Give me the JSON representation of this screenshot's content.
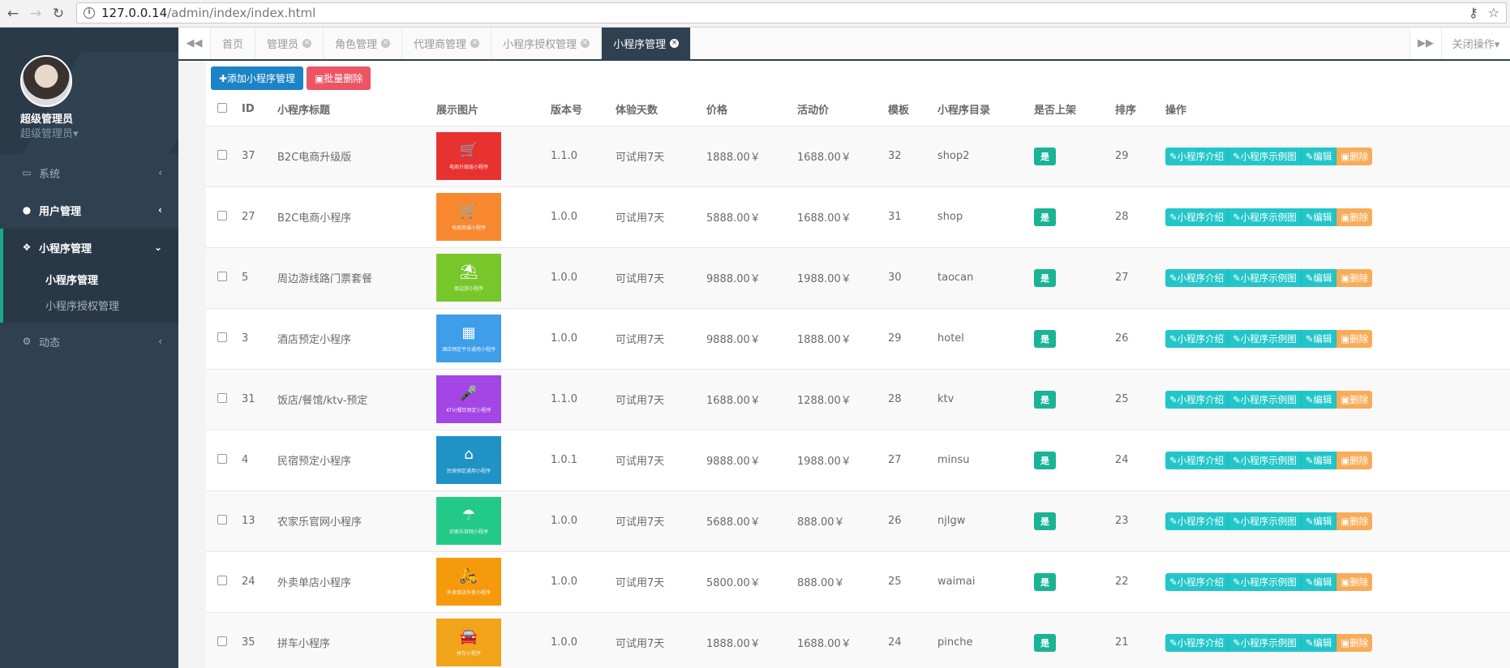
{
  "browser": {
    "url_host": "127.0.0.14",
    "url_path": "/admin/index/index.html"
  },
  "sidebar": {
    "user_name": "超级管理员",
    "user_role": "超级管理员▾",
    "menu": [
      {
        "label": "系统",
        "icon": "monitor-icon"
      },
      {
        "label": "用户管理",
        "icon": "user-icon"
      },
      {
        "label": "小程序管理",
        "icon": "wechat-icon"
      },
      {
        "label": "动态",
        "icon": "cogs-icon"
      }
    ],
    "submenu": [
      "小程序管理",
      "小程序授权管理"
    ]
  },
  "tabs": {
    "items": [
      "首页",
      "管理员",
      "角色管理",
      "代理商管理",
      "小程序授权管理",
      "小程序管理"
    ],
    "close_ops": "关闭操作▾"
  },
  "toolbar": {
    "add_label": "✚添加小程序管理",
    "batch_delete_label": "▣批量删除"
  },
  "table": {
    "headers": [
      "ID",
      "小程序标题",
      "展示图片",
      "版本号",
      "体验天数",
      "价格",
      "活动价",
      "模板",
      "小程序目录",
      "是否上架",
      "排序",
      "操作"
    ],
    "actions": [
      "✎小程序介绍",
      "✎小程序示例图",
      "✎编辑",
      "▣删除"
    ],
    "rows": [
      {
        "id": "37",
        "title": "B2C电商升级版",
        "thumb_color": "#e8322f",
        "thumb_icon": "🛒",
        "thumb_caption": "电商升级版小程序",
        "version": "1.1.0",
        "days": "可试用7天",
        "price": "1888.00￥",
        "promo": "1688.00￥",
        "template": "32",
        "dir": "shop2",
        "listed": "是",
        "sort": "29"
      },
      {
        "id": "27",
        "title": "B2C电商小程序",
        "thumb_color": "#f7882f",
        "thumb_icon": "🛒",
        "thumb_caption": "电商商城小程序",
        "version": "1.0.0",
        "days": "可试用7天",
        "price": "5888.00￥",
        "promo": "1688.00￥",
        "template": "31",
        "dir": "shop",
        "listed": "是",
        "sort": "28"
      },
      {
        "id": "5",
        "title": "周边游线路门票套餐",
        "thumb_color": "#78c72a",
        "thumb_icon": "⛱",
        "thumb_caption": "周边游小程序",
        "version": "1.0.0",
        "days": "可试用7天",
        "price": "9888.00￥",
        "promo": "1988.00￥",
        "template": "30",
        "dir": "taocan",
        "listed": "是",
        "sort": "27"
      },
      {
        "id": "3",
        "title": "酒店预定小程序",
        "thumb_color": "#3e9ee9",
        "thumb_icon": "▦",
        "thumb_caption": "酒店预定平台通用小程序",
        "version": "1.0.0",
        "days": "可试用7天",
        "price": "9888.00￥",
        "promo": "1888.00￥",
        "template": "29",
        "dir": "hotel",
        "listed": "是",
        "sort": "26"
      },
      {
        "id": "31",
        "title": "饭店/餐馆/ktv-预定",
        "thumb_color": "#a445e6",
        "thumb_icon": "🎤",
        "thumb_caption": "KTV/餐饮预定小程序",
        "version": "1.1.0",
        "days": "可试用7天",
        "price": "1688.00￥",
        "promo": "1288.00￥",
        "template": "28",
        "dir": "ktv",
        "listed": "是",
        "sort": "25"
      },
      {
        "id": "4",
        "title": "民宿预定小程序",
        "thumb_color": "#1f92c6",
        "thumb_icon": "⌂",
        "thumb_caption": "民宿预定通用小程序",
        "version": "1.0.1",
        "days": "可试用7天",
        "price": "9888.00￥",
        "promo": "1988.00￥",
        "template": "27",
        "dir": "minsu",
        "listed": "是",
        "sort": "24"
      },
      {
        "id": "13",
        "title": "农家乐官网小程序",
        "thumb_color": "#23c988",
        "thumb_icon": "☂",
        "thumb_caption": "农家乐官网小程序",
        "version": "1.0.0",
        "days": "可试用7天",
        "price": "5688.00￥",
        "promo": "888.00￥",
        "template": "26",
        "dir": "njlgw",
        "listed": "是",
        "sort": "23"
      },
      {
        "id": "24",
        "title": "外卖单店小程序",
        "thumb_color": "#f59a0c",
        "thumb_icon": "🛵",
        "thumb_caption": "外卖单店外卖小程序",
        "version": "1.0.0",
        "days": "可试用7天",
        "price": "5800.00￥",
        "promo": "888.00￥",
        "template": "25",
        "dir": "waimai",
        "listed": "是",
        "sort": "22"
      },
      {
        "id": "35",
        "title": "拼车小程序",
        "thumb_color": "#f1a31a",
        "thumb_icon": "🚘",
        "thumb_caption": "拼车小程序",
        "version": "1.0.0",
        "days": "可试用7天",
        "price": "1888.00￥",
        "promo": "1688.00￥",
        "template": "24",
        "dir": "pinche",
        "listed": "是",
        "sort": "21"
      }
    ]
  },
  "colors": {
    "sidebar": "#2f4050",
    "primary": "#1c84c6",
    "danger": "#ed5565",
    "info": "#23c6c8",
    "warning": "#f8ac59",
    "success": "#1ab394"
  }
}
